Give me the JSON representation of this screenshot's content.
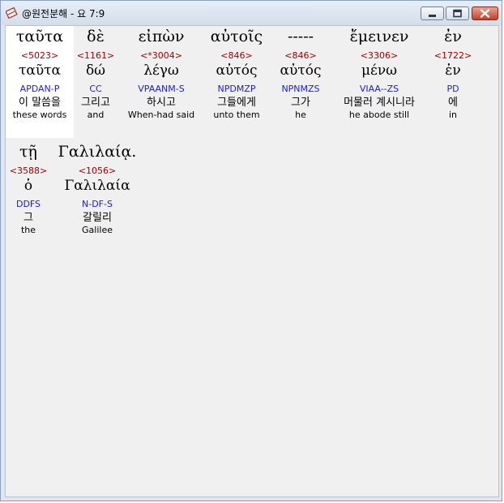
{
  "window": {
    "title": "@원전분해 - 요 7:9",
    "icon": "app-book-icon"
  },
  "colors": {
    "strong": "#a00000",
    "morph": "#1c1ccf",
    "titlebar": "#d3deea",
    "content_bg": "#f0f0f0",
    "selected_bg": "#ffffff"
  },
  "words": [
    {
      "greek": "ταῦτα",
      "strong": "<5023>",
      "lemma": "ταῦτα",
      "morph": "APDAN-P",
      "korean": "이 말씀을",
      "english": "these words",
      "selected": true
    },
    {
      "greek": "δὲ",
      "strong": "<1161>",
      "lemma": "δώ",
      "morph": "CC",
      "korean": "그리고",
      "english": "and"
    },
    {
      "greek": "εἰπὼν",
      "strong": "<*3004>",
      "lemma": "λέγω",
      "morph": "VPAANM-S",
      "korean": "하시고",
      "english": "When-had said"
    },
    {
      "greek": "αὐτοῖς",
      "strong": "<846>",
      "lemma": "αὐτός",
      "morph": "NPDMZP",
      "korean": "그들에게",
      "english": "unto them"
    },
    {
      "greek": "-----",
      "strong": "<846>",
      "lemma": "αὐτός",
      "morph": "NPNMZS",
      "korean": "그가",
      "english": "he"
    },
    {
      "greek": "ἔμεινεν",
      "strong": "<3306>",
      "lemma": "μένω",
      "morph": "VIAA--ZS",
      "korean": "머물러 계시니라",
      "english": "he abode still"
    },
    {
      "greek": "ἐν",
      "strong": "<1722>",
      "lemma": "ἐν",
      "morph": "PD",
      "korean": "에",
      "english": "in"
    },
    {
      "greek": "τῇ",
      "strong": "<3588>",
      "lemma": "ὁ",
      "morph": "DDFS",
      "korean": "그",
      "english": "the"
    },
    {
      "greek": "Γαλιλαίᾳ.",
      "strong": "<1056>",
      "lemma": "Γαλιλαία",
      "morph": "N-DF-S",
      "korean": "갈릴리",
      "english": "Galilee"
    }
  ]
}
